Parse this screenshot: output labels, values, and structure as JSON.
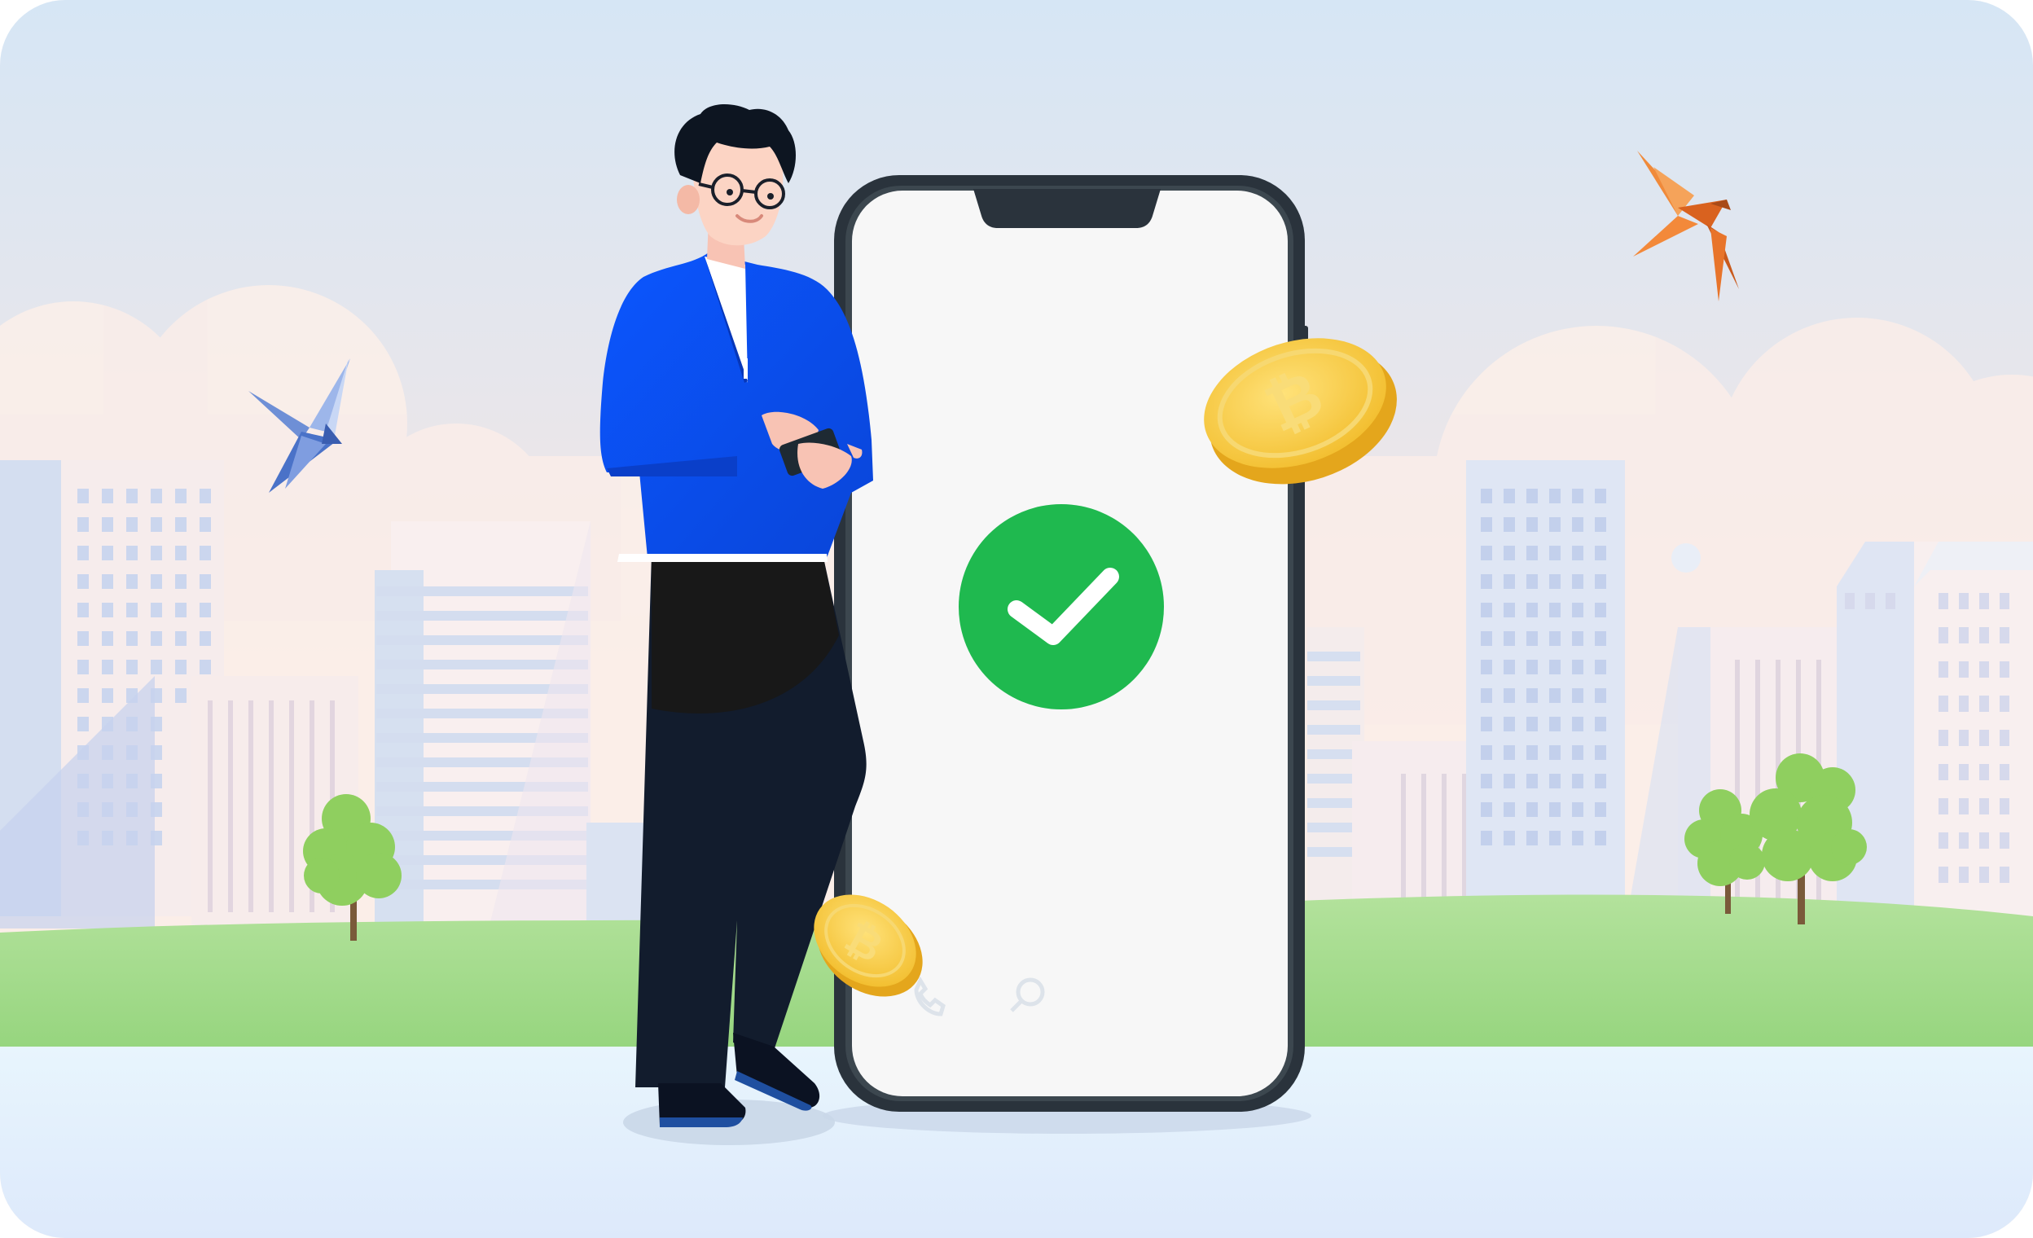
{
  "scene": {
    "subject": "payment-success-illustration",
    "status_icon": "check-icon",
    "coin_icon": "bitcoin-icon",
    "colors": {
      "sky_top": "#d6e6f5",
      "sky_bottom": "#fbe9e2",
      "grass": "#a6dc8f",
      "ground": "#e6f3fd",
      "success_green": "#1fb94f",
      "jacket_blue": "#0a4ff0",
      "coin_gold": "#f5c637",
      "bird_blue": "#4a72c8",
      "bird_orange": "#e8742a",
      "phone_frame": "#2a333c",
      "phone_screen": "#f7f7f7"
    }
  }
}
